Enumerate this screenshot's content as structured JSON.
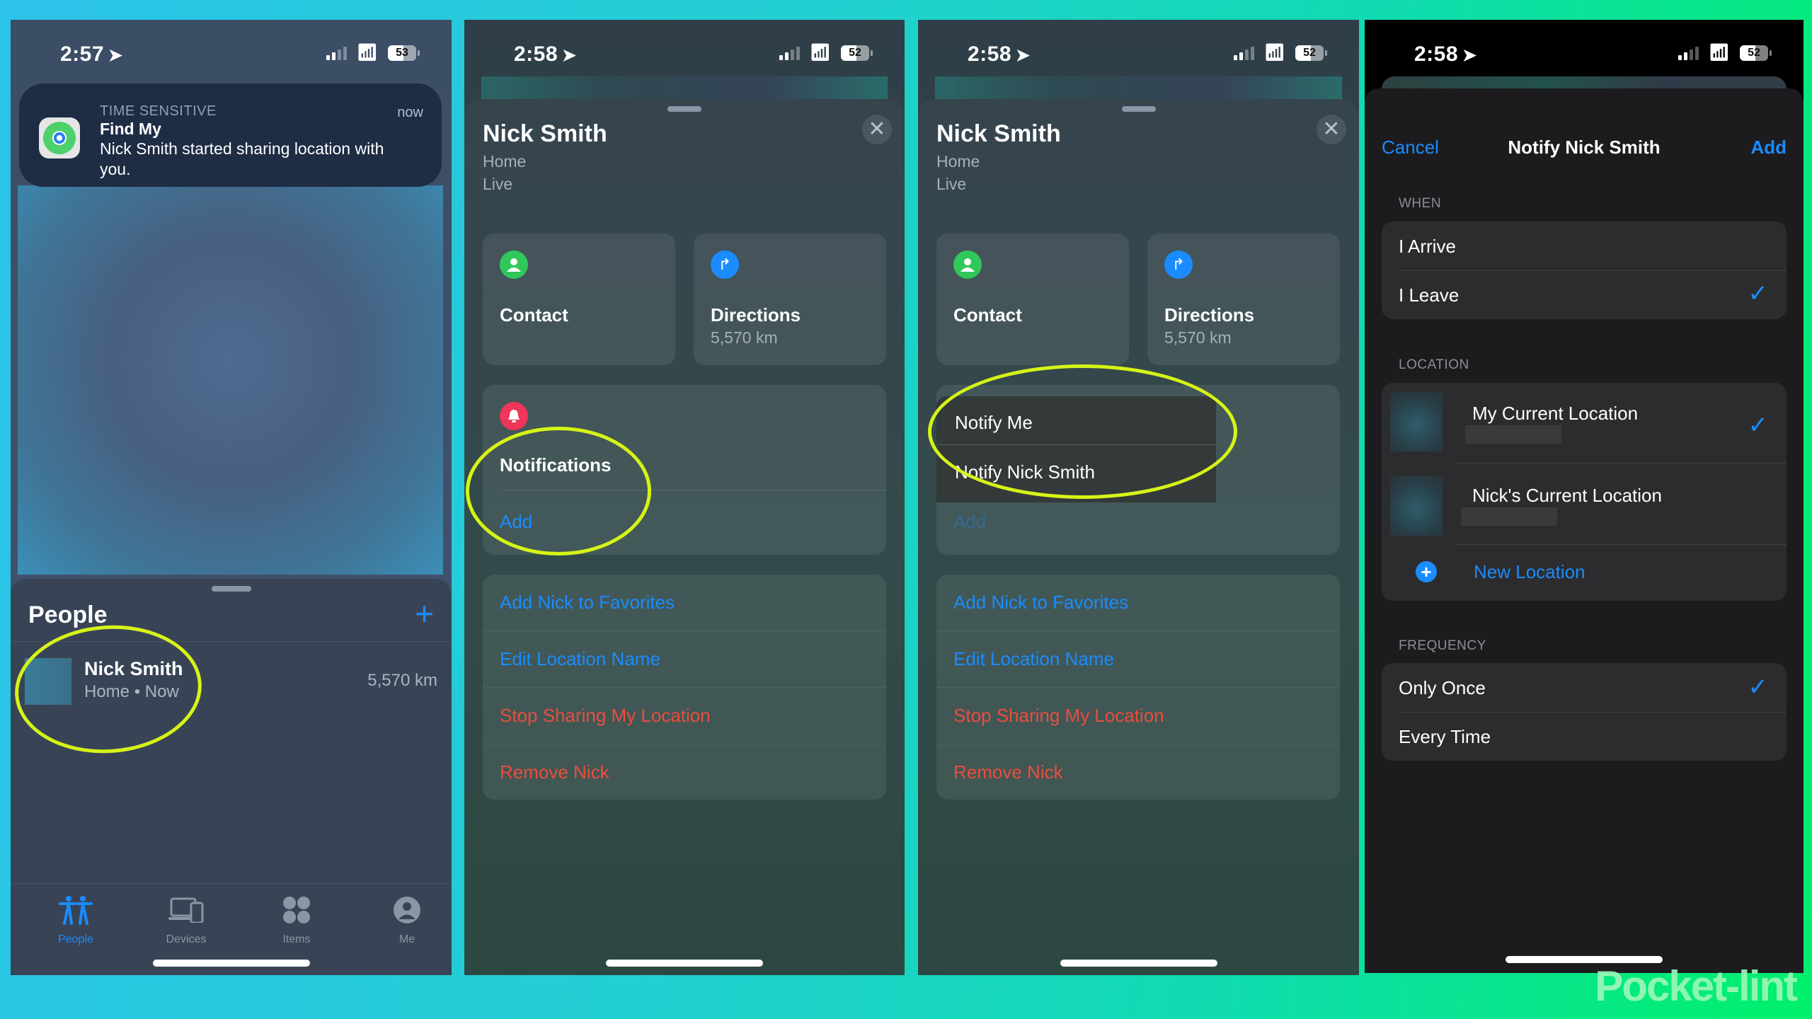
{
  "screens": [
    {
      "status": {
        "time": "2:57",
        "battery": "53"
      },
      "notification": {
        "category": "TIME SENSITIVE",
        "app": "Find My",
        "message": "Nick Smith started sharing location with you.",
        "time": "now"
      },
      "people": {
        "title": "People",
        "add_icon": "+",
        "list": [
          {
            "name": "Nick Smith",
            "subtitle": "Home • Now",
            "distance": "5,570 km"
          }
        ]
      },
      "tabs": [
        {
          "label": "People",
          "icon": "people-icon",
          "active": true
        },
        {
          "label": "Devices",
          "icon": "devices-icon",
          "active": false
        },
        {
          "label": "Items",
          "icon": "items-icon",
          "active": false
        },
        {
          "label": "Me",
          "icon": "me-icon",
          "active": false
        }
      ]
    },
    {
      "status": {
        "time": "2:58",
        "battery": "52"
      },
      "person": {
        "name": "Nick Smith",
        "location": "Home",
        "state": "Live"
      },
      "cards": {
        "contact": {
          "label": "Contact"
        },
        "directions": {
          "label": "Directions",
          "distance": "5,570 km"
        }
      },
      "notifications": {
        "title": "Notifications",
        "add": "Add"
      },
      "actions": [
        {
          "label": "Add Nick to Favorites",
          "color": "#1a8cff"
        },
        {
          "label": "Edit Location Name",
          "color": "#1a8cff"
        },
        {
          "label": "Stop Sharing My Location",
          "color": "#eb4d3d"
        },
        {
          "label": "Remove Nick",
          "color": "#eb4d3d"
        }
      ]
    },
    {
      "status": {
        "time": "2:58",
        "battery": "52"
      },
      "person": {
        "name": "Nick Smith",
        "location": "Home",
        "state": "Live"
      },
      "cards": {
        "contact": {
          "label": "Contact"
        },
        "directions": {
          "label": "Directions",
          "distance": "5,570 km"
        }
      },
      "notify_menu": [
        "Notify Me",
        "Notify Nick Smith"
      ],
      "notifications": {
        "add": "Add"
      },
      "actions": [
        {
          "label": "Add Nick to Favorites",
          "color": "#1a8cff"
        },
        {
          "label": "Edit Location Name",
          "color": "#1a8cff"
        },
        {
          "label": "Stop Sharing My Location",
          "color": "#eb4d3d"
        },
        {
          "label": "Remove Nick",
          "color": "#eb4d3d"
        }
      ]
    },
    {
      "status": {
        "time": "2:58",
        "battery": "52"
      },
      "nav": {
        "cancel": "Cancel",
        "title": "Notify Nick Smith",
        "add": "Add"
      },
      "when": {
        "header": "WHEN",
        "options": [
          {
            "label": "I Arrive",
            "selected": false
          },
          {
            "label": "I Leave",
            "selected": true
          }
        ]
      },
      "location": {
        "header": "LOCATION",
        "options": [
          {
            "label": "My Current Location",
            "selected": true
          },
          {
            "label": "Nick's Current Location",
            "selected": false
          }
        ],
        "new_location": "New Location"
      },
      "frequency": {
        "header": "FREQUENCY",
        "options": [
          {
            "label": "Only Once",
            "selected": true
          },
          {
            "label": "Every Time",
            "selected": false
          }
        ]
      }
    }
  ],
  "watermark": "Pocket-lint",
  "colors": {
    "accent": "#1a8cff",
    "destructive": "#eb4d3d",
    "highlight": "#d6f416",
    "contact": "#30c85a",
    "bell": "#f0355a"
  }
}
